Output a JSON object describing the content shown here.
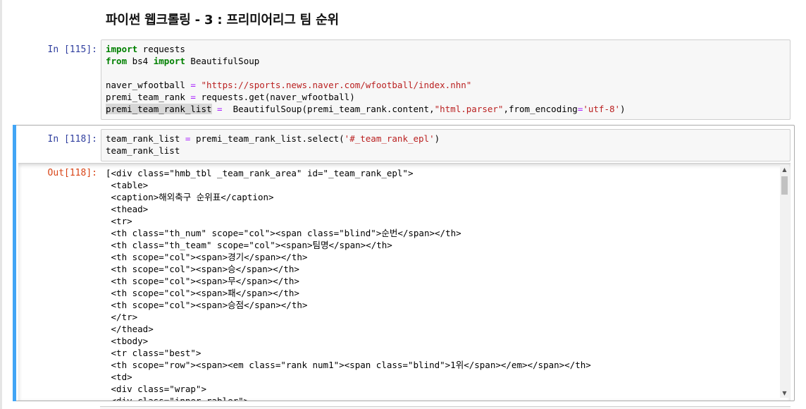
{
  "notebook": {
    "heading": "파이썬 웹크롤링 - 3 : 프리미어리그 팀 순위"
  },
  "cell1": {
    "prompt": "In [115]:",
    "lines": {
      "l1_kw": "import",
      "l1_rest": " requests",
      "l2_kw1": "from",
      "l2_mod": " bs4 ",
      "l2_kw2": "import",
      "l2_rest": " BeautifulSoup",
      "l4_var": "naver_wfootball ",
      "l4_eq": "=",
      "l4_sp": " ",
      "l4_str": "\"https://sports.news.naver.com/wfootball/index.nhn\"",
      "l5_var": "premi_team_rank ",
      "l5_eq": "=",
      "l5_rest": " requests.get(naver_wfootball)",
      "l6_var": "premi_team_rank_list",
      "l6_sp": " ",
      "l6_eq": "=",
      "l6_mid": "  BeautifulSoup(premi_team_rank.content,",
      "l6_str1": "\"html.parser\"",
      "l6_mid2": ",from_encoding",
      "l6_eq2": "=",
      "l6_str2": "'utf-8'",
      "l6_end": ")"
    }
  },
  "cell2": {
    "prompt": "In [118]:",
    "lines": {
      "l1_var": "team_rank_list ",
      "l1_eq": "=",
      "l1_mid": " premi_team_rank_list.select(",
      "l1_str": "'#_team_rank_epl'",
      "l1_end": ")",
      "l2": "team_rank_list"
    },
    "out_prompt": "Out[118]:",
    "output": [
      "[<div class=\"hmb_tbl _team_rank_area\" id=\"_team_rank_epl\">",
      " <table>",
      " <caption>해외축구 순위표</caption>",
      " <thead>",
      " <tr>",
      " <th class=\"th_num\" scope=\"col\"><span class=\"blind\">순번</span></th>",
      " <th class=\"th_team\" scope=\"col\"><span>팀명</span></th>",
      " <th scope=\"col\"><span>경기</span></th>",
      " <th scope=\"col\"><span>승</span></th>",
      " <th scope=\"col\"><span>무</span></th>",
      " <th scope=\"col\"><span>패</span></th>",
      " <th scope=\"col\"><span>승점</span></th>",
      " </tr>",
      " </thead>",
      " <tbody>",
      " <tr class=\"best\">",
      " <th scope=\"row\"><span><em class=\"rank num1\"><span class=\"blind\">1위</span></em></span></th>",
      " <td>",
      " <div class=\"wrap\">",
      " <div class=\"inner_rabler\">"
    ]
  },
  "icons": {
    "scroll_up": "triangle-up-icon",
    "scroll_down": "triangle-down-icon"
  },
  "colors": {
    "selected_bar": "#42a5f5",
    "prompt_in": "#303f9f",
    "prompt_out": "#d84315",
    "keyword": "#008000",
    "string": "#ba2121",
    "operator": "#aa22ff"
  }
}
